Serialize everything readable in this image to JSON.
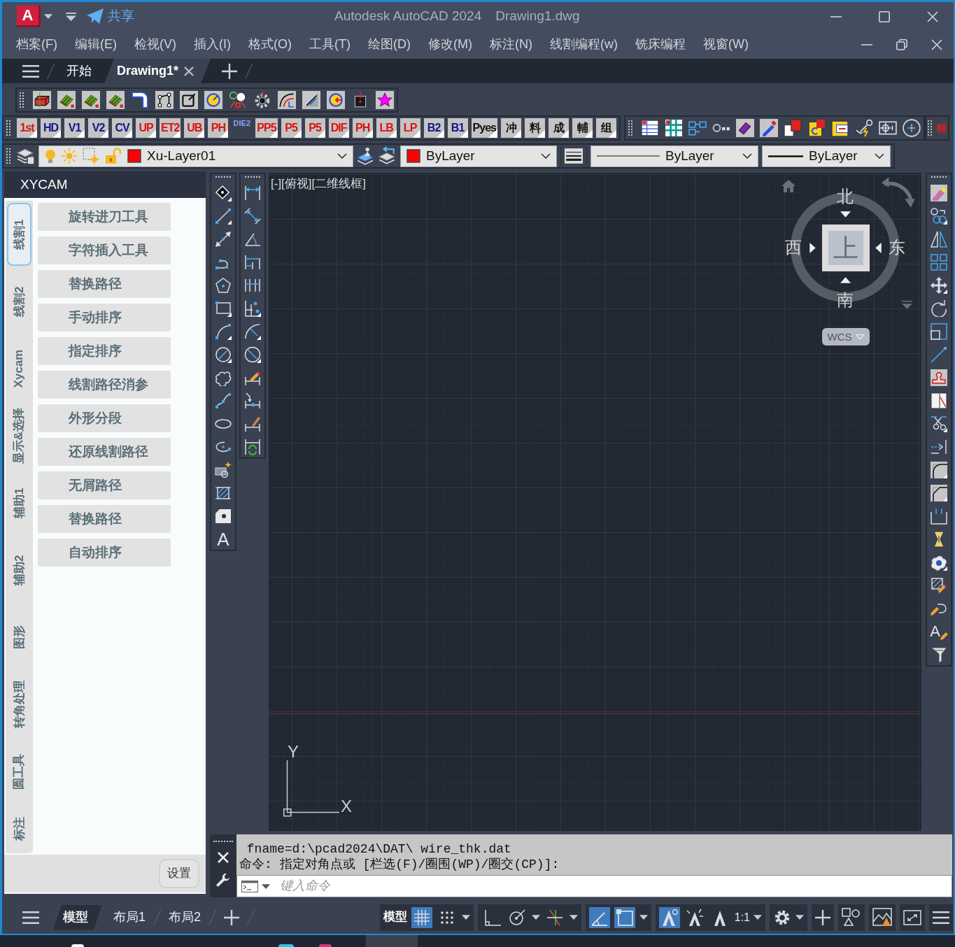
{
  "window": {
    "logo": "A",
    "share": "共享",
    "title": "Autodesk AutoCAD 2024",
    "document": "Drawing1.dwg"
  },
  "menu": [
    "档案(F)",
    "编辑(E)",
    "检视(V)",
    "插入(I)",
    "格式(O)",
    "工具(T)",
    "绘图(D)",
    "修改(M)",
    "标注(N)",
    "线割编程(w)",
    "铣床编程",
    "视窗(W)"
  ],
  "file_tabs": [
    {
      "label": "开始",
      "selected": false
    },
    {
      "label": "Drawing1*",
      "selected": true
    }
  ],
  "macro_toolbar": [
    {
      "label": "1st",
      "color": "#e01010",
      "kind": "tile"
    },
    {
      "label": "HD",
      "color": "#14148c",
      "kind": "tile"
    },
    {
      "label": "V1",
      "color": "#14148c",
      "kind": "tile"
    },
    {
      "label": "V2",
      "color": "#14148c",
      "kind": "tile"
    },
    {
      "label": "CV",
      "color": "#14148c",
      "kind": "tile"
    },
    {
      "label": "UP",
      "color": "#e01010",
      "kind": "tile"
    },
    {
      "label": "ET2",
      "color": "#e01010",
      "kind": "tile"
    },
    {
      "label": "UB",
      "color": "#e01010",
      "kind": "tile"
    },
    {
      "label": "PH",
      "color": "#e01010",
      "kind": "tile"
    },
    {
      "label": "DIE2",
      "color": "#8aa2ff",
      "kind": "bare"
    },
    {
      "label": "PP5",
      "color": "#e01010",
      "kind": "tile"
    },
    {
      "label": "P5",
      "color": "#e01010",
      "kind": "tile"
    },
    {
      "label": "P5",
      "color": "#e01010",
      "kind": "tile"
    },
    {
      "label": "DIF",
      "color": "#e01010",
      "kind": "tile"
    },
    {
      "label": "PH",
      "color": "#e01010",
      "kind": "tile"
    },
    {
      "label": "LB",
      "color": "#e01010",
      "kind": "tile"
    },
    {
      "label": "LP",
      "color": "#e01010",
      "kind": "tile"
    },
    {
      "label": "B2",
      "color": "#14148c",
      "kind": "tile"
    },
    {
      "label": "B1",
      "color": "#14148c",
      "kind": "tile"
    },
    {
      "label": "Pyes",
      "color": "#111111",
      "kind": "tile"
    },
    {
      "label": "冲",
      "color": "#111111",
      "kind": "tile"
    },
    {
      "label": "料",
      "color": "#111111",
      "kind": "tile"
    },
    {
      "label": "成",
      "color": "#111111",
      "kind": "tile"
    },
    {
      "label": "輔",
      "color": "#111111",
      "kind": "tile"
    },
    {
      "label": "组",
      "color": "#111111",
      "kind": "tile"
    }
  ],
  "overflow_toolbar": {
    "label": "輔"
  },
  "layer_toolbar": {
    "layer": "Xu-Layer01",
    "color_control": "ByLayer",
    "linetype": "ByLayer",
    "lineweight": "ByLayer"
  },
  "draw_toolbar": {
    "text_tool": "A"
  },
  "modify_toolbar": {
    "text_edit_tool": "A"
  },
  "side_panel": {
    "title": "XYCAM",
    "tabs": [
      {
        "label": "线割1",
        "selected": true
      },
      {
        "label": "线割2",
        "selected": false
      },
      {
        "label": "Xycam",
        "selected": false
      },
      {
        "label": "显示&选择",
        "selected": false
      },
      {
        "label": "辅助1",
        "selected": false
      },
      {
        "label": "辅助2",
        "selected": false
      },
      {
        "label": "图形",
        "selected": false
      },
      {
        "label": "转角处理",
        "selected": false
      },
      {
        "label": "圆工具",
        "selected": false
      },
      {
        "label": "标注",
        "selected": false
      }
    ],
    "buttons": [
      "旋转进刀工具",
      "字符插入工具",
      "替换路径",
      "手动排序",
      "指定排序",
      "线割路径消参",
      "外形分段",
      "还原线割路径",
      "无屑路径",
      "替换路径",
      "自动排序"
    ],
    "settings": "设置"
  },
  "viewport": {
    "controls": [
      "[-]",
      "[俯视]",
      "[二维线框]"
    ],
    "viewcube": {
      "top": "上",
      "north": "北",
      "south": "南",
      "west": "西",
      "east": "东",
      "coordinate_system": "WCS"
    },
    "ucs_icon": {
      "x": "X",
      "y": "Y"
    }
  },
  "command_line": {
    "history": [
      " fname=d:\\pcad2024\\DAT\\ wire_thk.dat",
      "命令: 指定对角点或 [栏选(F)/圈围(WP)/圈交(CP)]:"
    ],
    "placeholder": "键入命令"
  },
  "status_bar": {
    "layout_tabs": [
      {
        "label": "模型",
        "selected": true
      },
      {
        "label": "布局1",
        "selected": false
      },
      {
        "label": "布局2",
        "selected": false
      }
    ],
    "space": "模型",
    "toggles": [
      {
        "kind": "grid",
        "on": true
      },
      {
        "kind": "snap",
        "on": false
      },
      {
        "kind": "ortho",
        "on": false
      },
      {
        "kind": "polar",
        "on": false
      },
      {
        "kind": "isodraft",
        "on": false
      },
      {
        "kind": "tracking",
        "on": true
      },
      {
        "kind": "osnap",
        "on": true
      },
      {
        "kind": "annotation_visibility",
        "on": true
      },
      {
        "kind": "autoscale",
        "on": false
      },
      {
        "kind": "annotation_scale",
        "on": false
      }
    ],
    "annotation_scale": "1:1"
  }
}
